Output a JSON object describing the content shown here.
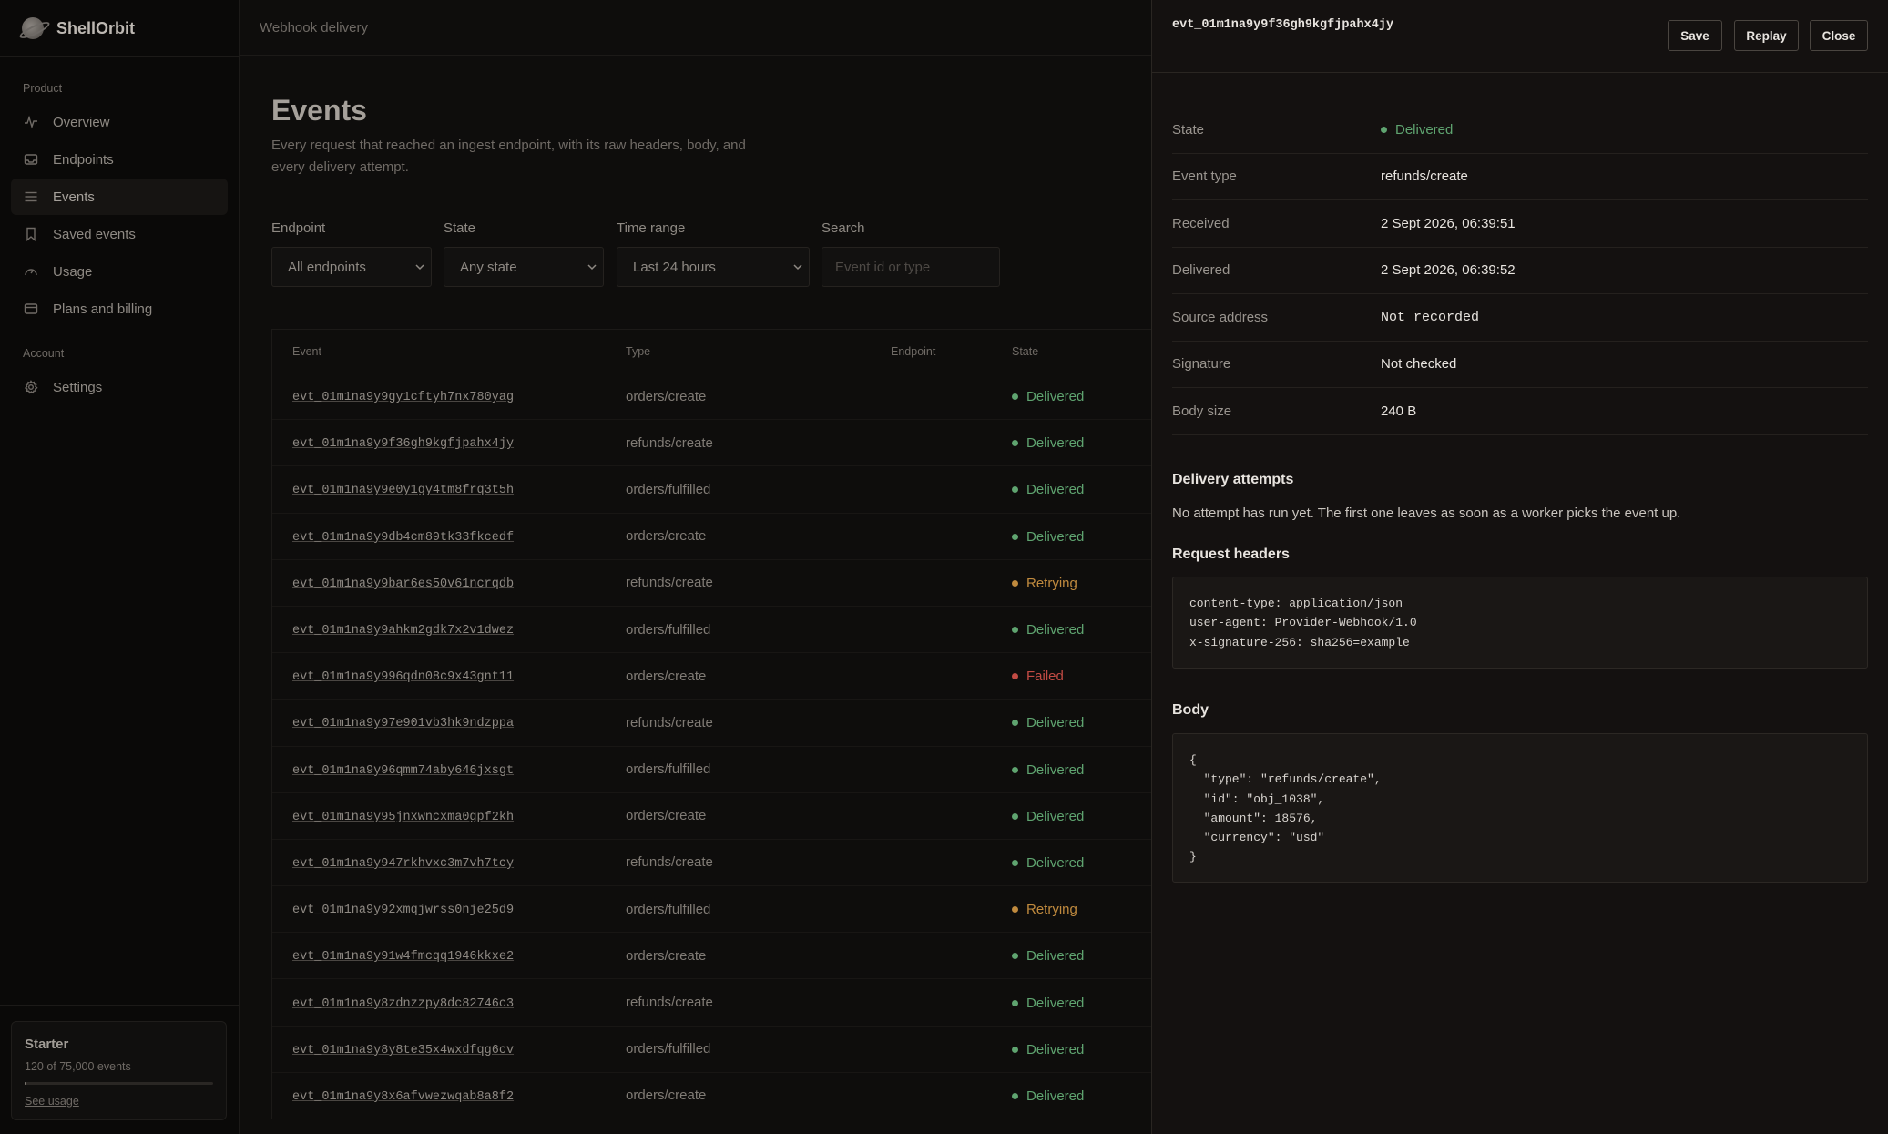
{
  "sidebar": {
    "brand": "ShellOrbit",
    "sections": [
      {
        "label": "Product",
        "items": [
          {
            "label": "Overview",
            "icon": "activity-icon"
          },
          {
            "label": "Endpoints",
            "icon": "inbox-icon"
          },
          {
            "label": "Events",
            "icon": "list-icon",
            "active": true
          },
          {
            "label": "Saved events",
            "icon": "bookmark-icon"
          },
          {
            "label": "Usage",
            "icon": "gauge-icon"
          },
          {
            "label": "Plans and billing",
            "icon": "credit-card-icon"
          }
        ]
      },
      {
        "label": "Account",
        "items": [
          {
            "label": "Settings",
            "icon": "gear-icon"
          }
        ]
      }
    ],
    "plan": {
      "name": "Starter",
      "usage": "120 of 75,000 events",
      "used_fraction": 0.0016,
      "link": "See usage"
    }
  },
  "topbar": {
    "title": "Webhook delivery"
  },
  "main": {
    "title": "Events",
    "description": "Every request that reached an ingest endpoint, with its raw headers, body, and every delivery attempt.",
    "filters": {
      "endpoint": {
        "label": "Endpoint",
        "value": "All endpoints"
      },
      "state": {
        "label": "State",
        "value": "Any state"
      },
      "time_range": {
        "label": "Time range",
        "value": "Last 24 hours"
      },
      "search": {
        "label": "Search",
        "placeholder": "Event id or type"
      }
    },
    "table": {
      "columns": [
        "Event",
        "Type",
        "Endpoint",
        "State"
      ],
      "rows": [
        {
          "id": "evt_01m1na9y9gy1cftyh7nx780yag",
          "type": "orders/create",
          "endpoint": "",
          "state": "Delivered"
        },
        {
          "id": "evt_01m1na9y9f36gh9kgfjpahx4jy",
          "type": "refunds/create",
          "endpoint": "",
          "state": "Delivered"
        },
        {
          "id": "evt_01m1na9y9e0y1gy4tm8frq3t5h",
          "type": "orders/fulfilled",
          "endpoint": "",
          "state": "Delivered"
        },
        {
          "id": "evt_01m1na9y9db4cm89tk33fkcedf",
          "type": "orders/create",
          "endpoint": "",
          "state": "Delivered"
        },
        {
          "id": "evt_01m1na9y9bar6es50v61ncrqdb",
          "type": "refunds/create",
          "endpoint": "",
          "state": "Retrying"
        },
        {
          "id": "evt_01m1na9y9ahkm2gdk7x2v1dwez",
          "type": "orders/fulfilled",
          "endpoint": "",
          "state": "Delivered"
        },
        {
          "id": "evt_01m1na9y996qdn08c9x43gnt11",
          "type": "orders/create",
          "endpoint": "",
          "state": "Failed"
        },
        {
          "id": "evt_01m1na9y97e901vb3hk9ndzppa",
          "type": "refunds/create",
          "endpoint": "",
          "state": "Delivered"
        },
        {
          "id": "evt_01m1na9y96qmm74aby646jxsgt",
          "type": "orders/fulfilled",
          "endpoint": "",
          "state": "Delivered"
        },
        {
          "id": "evt_01m1na9y95jnxwncxma0gpf2kh",
          "type": "orders/create",
          "endpoint": "",
          "state": "Delivered"
        },
        {
          "id": "evt_01m1na9y947rkhvxc3m7vh7tcy",
          "type": "refunds/create",
          "endpoint": "",
          "state": "Delivered"
        },
        {
          "id": "evt_01m1na9y92xmqjwrss0nje25d9",
          "type": "orders/fulfilled",
          "endpoint": "",
          "state": "Retrying"
        },
        {
          "id": "evt_01m1na9y91w4fmcqq1946kkxe2",
          "type": "orders/create",
          "endpoint": "",
          "state": "Delivered"
        },
        {
          "id": "evt_01m1na9y8zdnzzpy8dc82746c3",
          "type": "refunds/create",
          "endpoint": "",
          "state": "Delivered"
        },
        {
          "id": "evt_01m1na9y8y8te35x4wxdfqg6cv",
          "type": "orders/fulfilled",
          "endpoint": "",
          "state": "Delivered"
        },
        {
          "id": "evt_01m1na9y8x6afvwezwqab8a8f2",
          "type": "orders/create",
          "endpoint": "",
          "state": "Delivered"
        }
      ]
    }
  },
  "state_colors": {
    "Delivered": "#5fa470",
    "Retrying": "#c08a3e",
    "Failed": "#c24b44"
  },
  "drawer": {
    "event_id": "evt_01m1na9y9f36gh9kgfjpahx4jy",
    "buttons": {
      "save": "Save",
      "replay": "Replay",
      "close": "Close"
    },
    "details": [
      {
        "key": "State",
        "value": "Delivered",
        "kind": "state"
      },
      {
        "key": "Event type",
        "value": "refunds/create"
      },
      {
        "key": "Received",
        "value": "2 Sept 2026, 06:39:51"
      },
      {
        "key": "Delivered",
        "value": "2 Sept 2026, 06:39:52"
      },
      {
        "key": "Source address",
        "value": "Not recorded",
        "kind": "mono"
      },
      {
        "key": "Signature",
        "value": "Not checked"
      },
      {
        "key": "Body size",
        "value": "240 B"
      }
    ],
    "attempts": {
      "title": "Delivery attempts",
      "text": "No attempt has run yet. The first one leaves as soon as a worker picks the event up."
    },
    "headers": {
      "title": "Request headers",
      "lines": [
        "content-type: application/json",
        "user-agent: Provider-Webhook/1.0",
        "x-signature-256: sha256=example"
      ]
    },
    "body": {
      "title": "Body",
      "lines": [
        "{",
        "  \"type\": \"refunds/create\",",
        "  \"id\": \"obj_1038\",",
        "  \"amount\": 18576,",
        "  \"currency\": \"usd\"",
        "}"
      ]
    }
  }
}
